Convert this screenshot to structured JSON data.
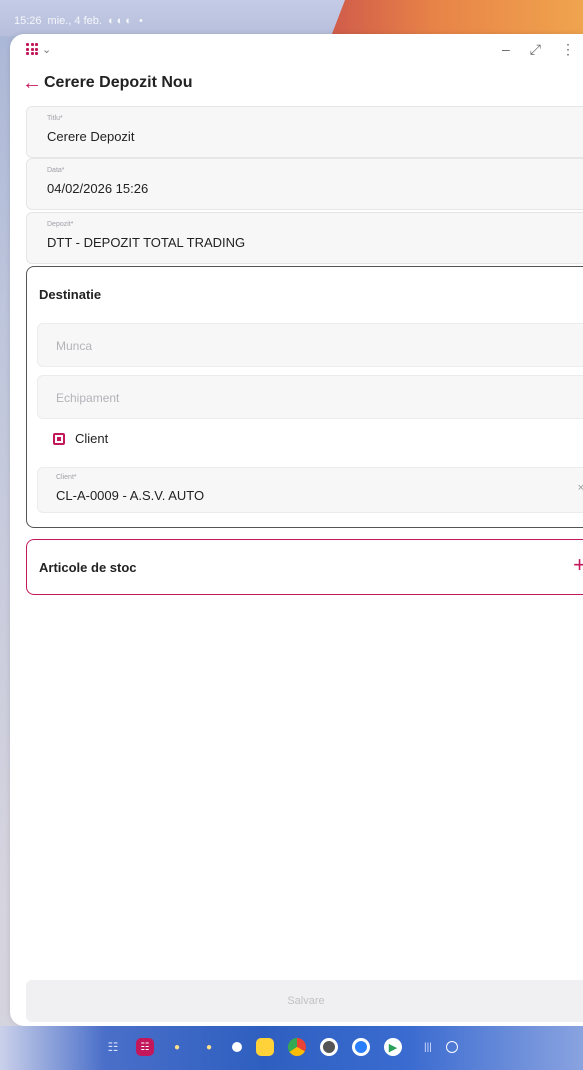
{
  "status_bar": {
    "time": "15:26",
    "date": "mie., 4 feb.",
    "icons": "◐◐◐ •"
  },
  "header": {
    "title": "Cerere Depozit Nou"
  },
  "form": {
    "title_field": {
      "label": "Titlu*",
      "value": "Cerere Depozit"
    },
    "date_field": {
      "label": "Data*",
      "value": "04/02/2026 15:26"
    },
    "depot_field": {
      "label": "Depozit*",
      "value": "DTT - DEPOZIT TOTAL TRADING"
    }
  },
  "destination": {
    "title": "Destinatie",
    "work_placeholder": "Munca",
    "equipment_placeholder": "Echipament",
    "client_checkbox_label": "Client",
    "client_checked": true,
    "client_field": {
      "label": "Client*",
      "value": "CL-A-0009 - A.S.V. AUTO"
    }
  },
  "articles": {
    "title": "Articole de stoc",
    "add_symbol": "+"
  },
  "save_button": {
    "label": "Salvare"
  },
  "colors": {
    "accent": "#c2185b",
    "field_background": "#f7f7f8"
  },
  "icons": {
    "app_menu": "grid-icon",
    "back": "arrow-left-icon",
    "minimize": "minimize-icon",
    "restore": "restore-icon",
    "maximize": "maximize-icon",
    "dropdown": "chevron-down-icon",
    "clear": "close-icon",
    "add": "plus-icon"
  }
}
